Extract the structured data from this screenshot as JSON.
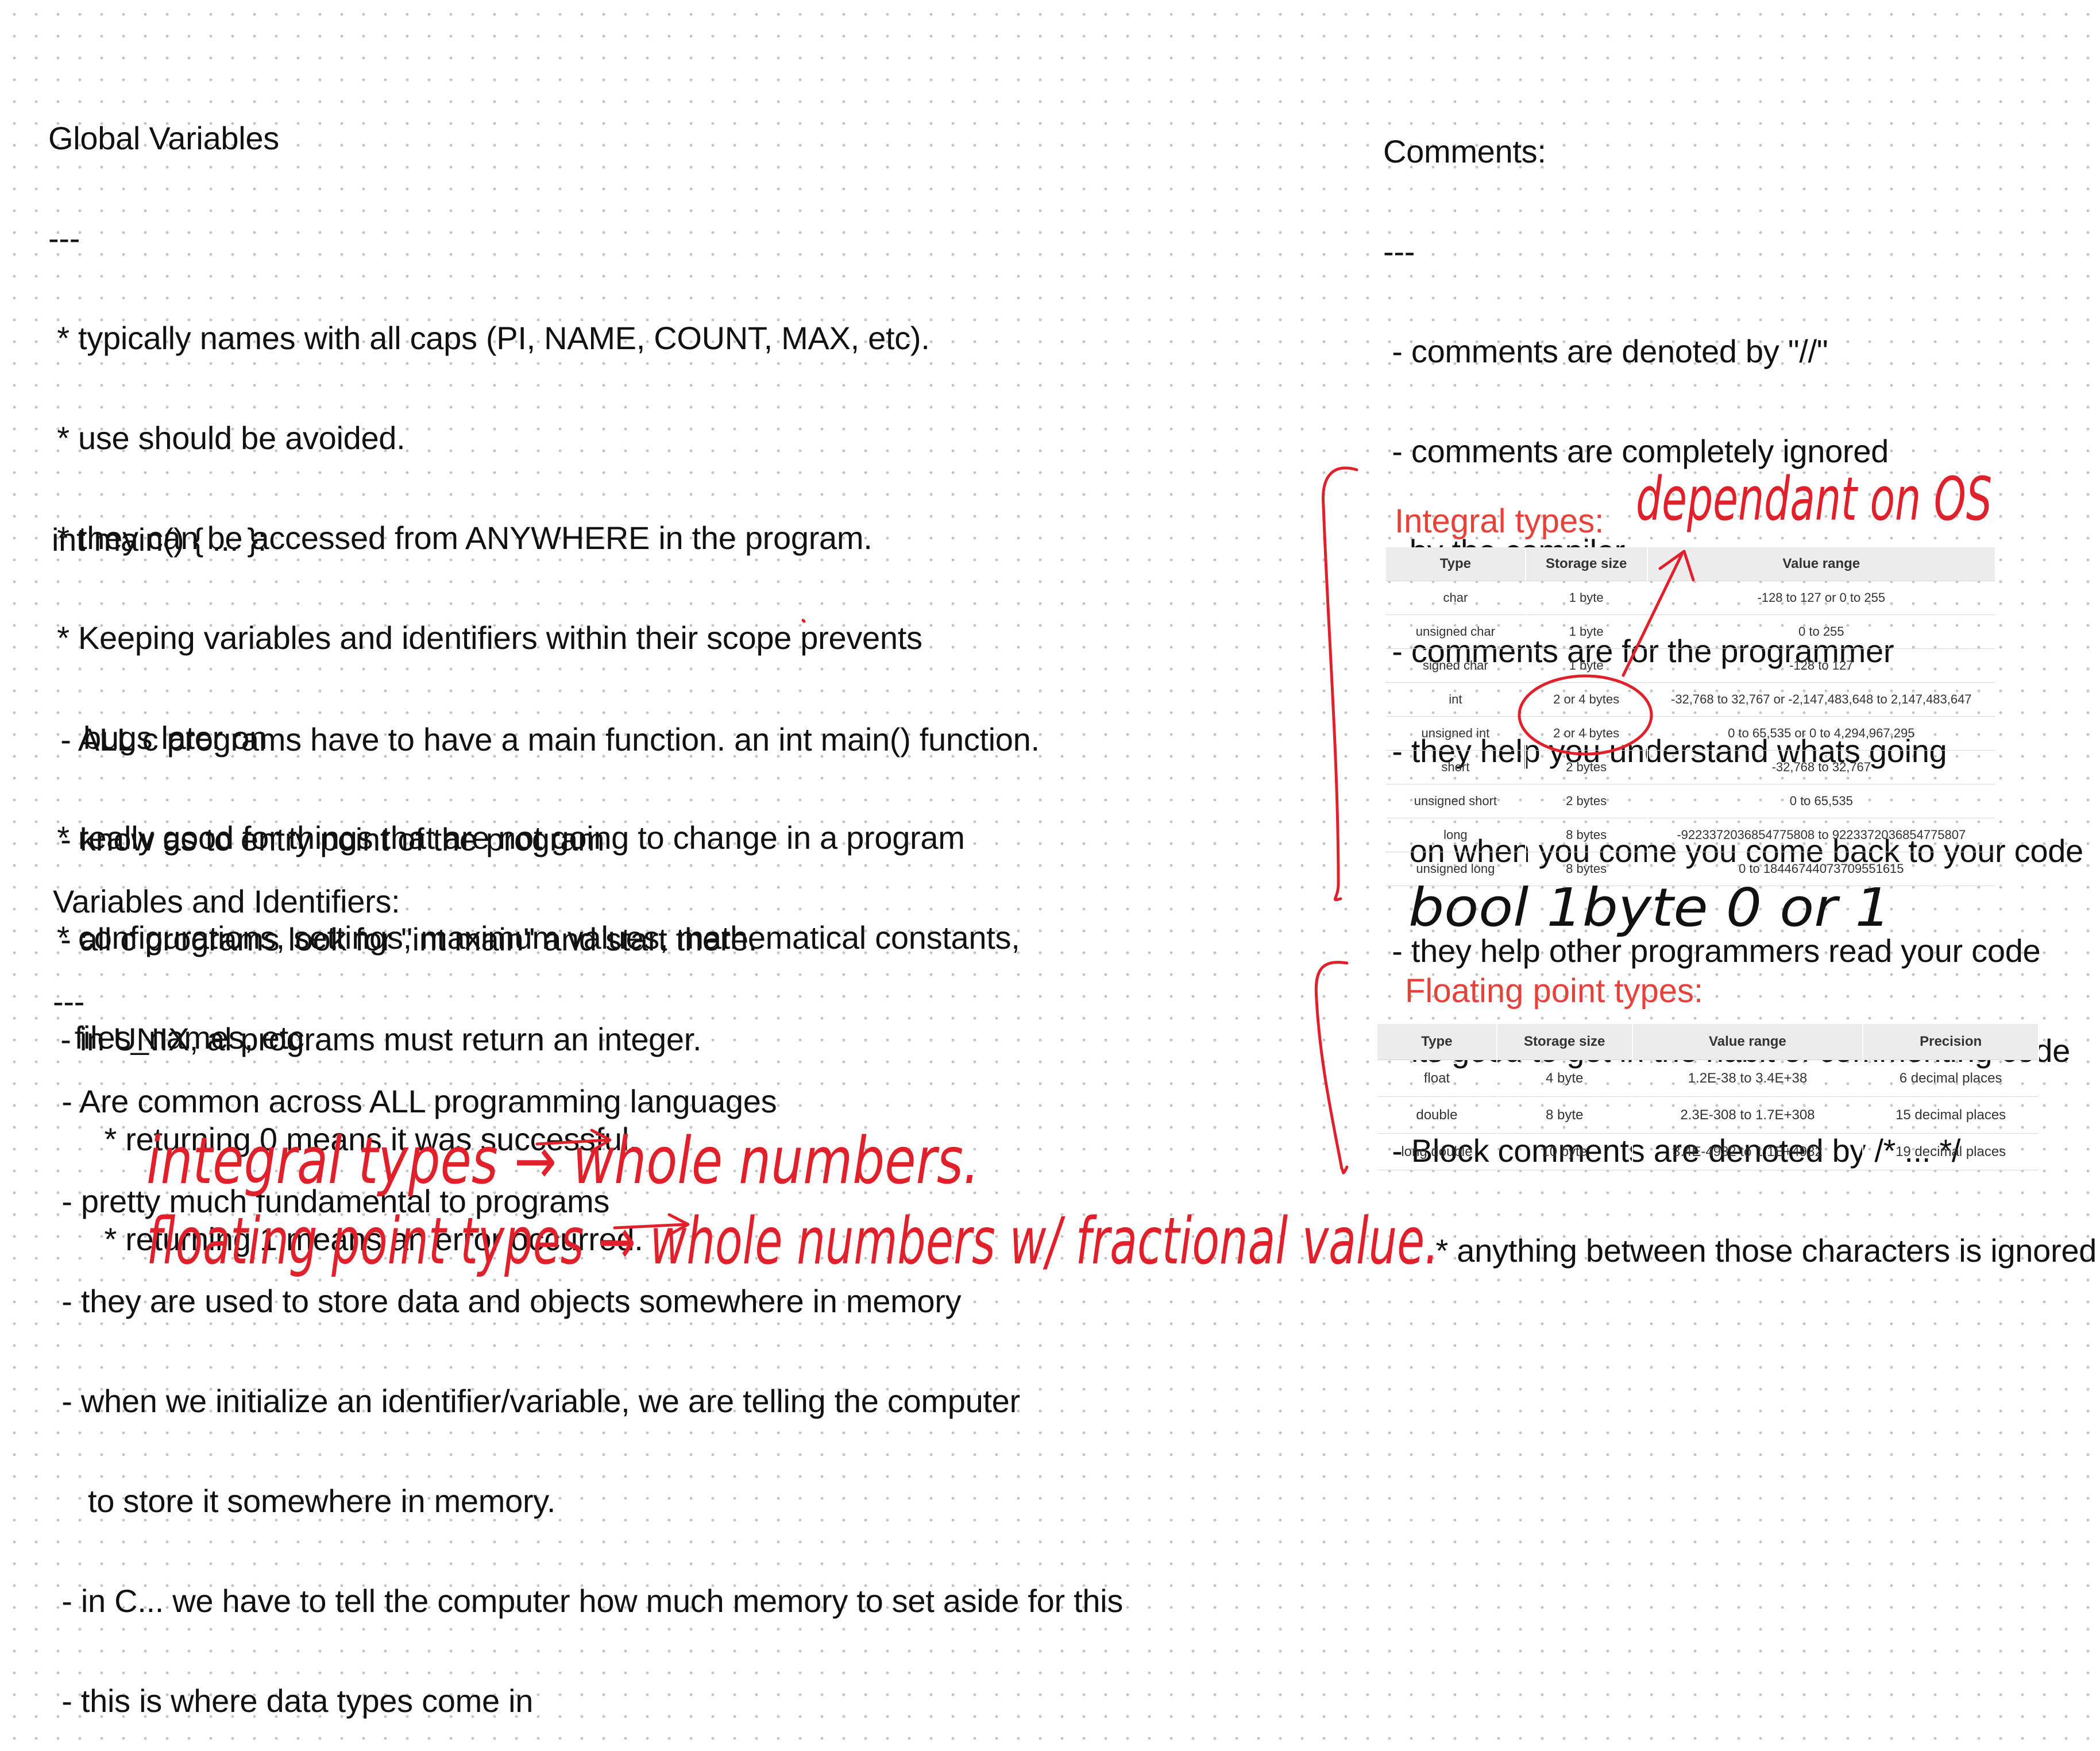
{
  "global": {
    "title": "Global Variables",
    "rule": "---",
    "lines": [
      " * typically names with all caps (PI, NAME, COUNT, MAX, etc).",
      " * use should be avoided.",
      " * they can be accessed from ANYWHERE in the program.",
      " * Keeping variables and identifiers within their scope prevents",
      "    bugs later on",
      " * really good for things that are not going to change in a program",
      " * configurations, settings, maximum values, mathematical constants,",
      "   files_names, etc"
    ]
  },
  "main_fn": {
    "title": "int main() { ... }:",
    "lines": [
      " - ALL c programs have to have a main function. an int main() function.",
      " - know as to entry point of the program",
      " - all c programs look for \"int main\" and start there.",
      " - in UNIX, al programs must return an integer.",
      "      * returning 0 means it was successful.",
      "      * returning 1 means an error occurred."
    ]
  },
  "variables": {
    "title": "Variables and Identifiers:",
    "rule": "---",
    "lines": [
      " - Are common across ALL programming languages",
      " - pretty much fundamental to programs",
      " - they are used to store data and objects somewhere in memory",
      " - when we initialize an identifier/variable, we are telling the computer",
      "    to store it somewhere in memory.",
      " - in C... we have to tell the computer how much memory to set aside for this",
      " - this is where data types come in"
    ]
  },
  "comments": {
    "title": "Comments:",
    "rule": "---",
    "lines": [
      " - comments are denoted by \"//\"",
      " - comments are completely ignored",
      "   by the compiler",
      " - comments are for the programmer",
      " - they help you understand whats going",
      "   on when you come you come back to your code",
      " - they help other programmers read your code",
      " - its good to get in the habit of commenting code",
      " - Block comments are denoted by /* ... */",
      "      * anything between those characters is ignored"
    ]
  },
  "integral_table": {
    "title": "Integral types:",
    "headers": [
      "Type",
      "Storage size",
      "Value range"
    ],
    "rows": [
      [
        "char",
        "1 byte",
        "-128 to 127 or 0 to 255"
      ],
      [
        "unsigned char",
        "1 byte",
        "0 to 255"
      ],
      [
        "signed char",
        "1 byte",
        "-128 to 127"
      ],
      [
        "int",
        "2 or 4 bytes",
        "-32,768 to 32,767 or -2,147,483,648 to 2,147,483,647"
      ],
      [
        "unsigned int",
        "2 or 4 bytes",
        "0 to 65,535 or 0 to 4,294,967,295"
      ],
      [
        "short",
        "2 bytes",
        "-32,768 to 32,767"
      ],
      [
        "unsigned short",
        "2 bytes",
        "0 to 65,535"
      ],
      [
        "long",
        "8 bytes",
        "-9223372036854775808 to 9223372036854775807"
      ],
      [
        "unsigned long",
        "8 bytes",
        "0 to 18446744073709551615"
      ]
    ]
  },
  "float_table": {
    "title": "Floating point types:",
    "headers": [
      "Type",
      "Storage size",
      "Value range",
      "Precision"
    ],
    "rows": [
      [
        "float",
        "4 byte",
        "1.2E-38 to 3.4E+38",
        "6 decimal places"
      ],
      [
        "double",
        "8 byte",
        "2.3E-308 to 1.7E+308",
        "15 decimal places"
      ],
      [
        "long double",
        "10 byte",
        "3.4E-4932 to 1.1E+4932",
        "19 decimal places"
      ]
    ]
  },
  "handwriting": {
    "dependant": "dependant on OS",
    "bool_row": "bool   1byte   0  or  1",
    "integral_note": "integral types → whole numbers.",
    "floating_note": "floating point types → whole numbers w/ fractional value."
  },
  "colors": {
    "accent": "#e8413a",
    "ink": "#e0202a",
    "text": "#111111"
  }
}
